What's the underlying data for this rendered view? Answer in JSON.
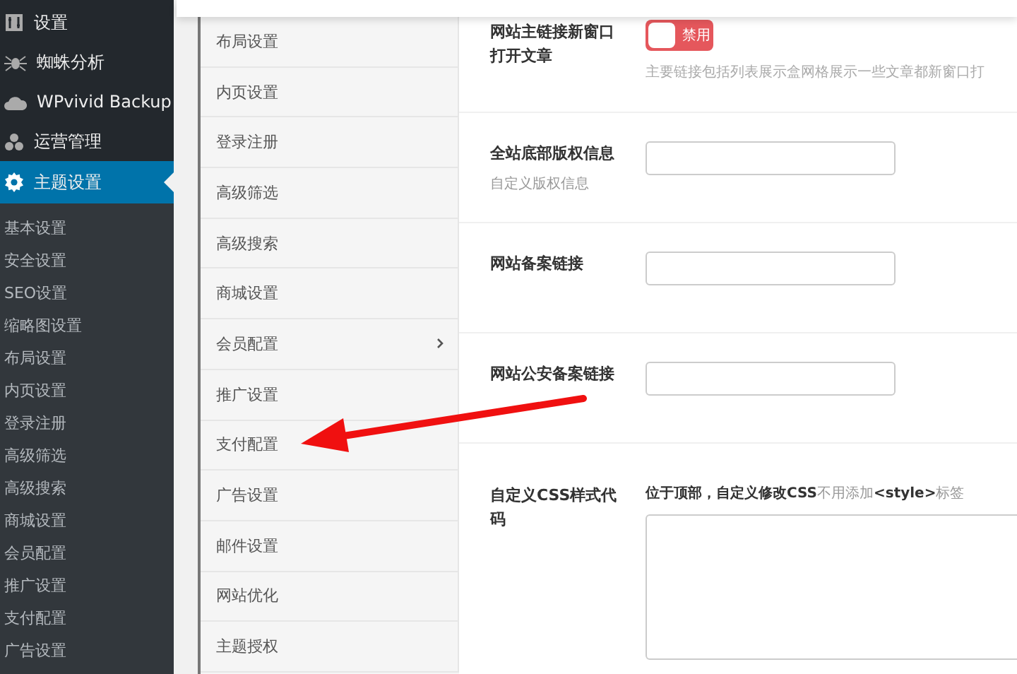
{
  "admin_menu": [
    {
      "label": "设置",
      "selected": false
    },
    {
      "label": "蜘蛛分析",
      "selected": false
    },
    {
      "label": "WPvivid Backup",
      "selected": false
    },
    {
      "label": "运营管理",
      "selected": false
    },
    {
      "label": "主题设置",
      "selected": true
    }
  ],
  "submenu": [
    "基本设置",
    "安全设置",
    "SEO设置",
    "缩略图设置",
    "布局设置",
    "内页设置",
    "登录注册",
    "高级筛选",
    "高级搜索",
    "商城设置",
    "会员配置",
    "推广设置",
    "支付配置",
    "广告设置"
  ],
  "settings_nav": [
    {
      "label": "布局设置",
      "has_children": false
    },
    {
      "label": "内页设置",
      "has_children": false
    },
    {
      "label": "登录注册",
      "has_children": false
    },
    {
      "label": "高级筛选",
      "has_children": false
    },
    {
      "label": "高级搜索",
      "has_children": false
    },
    {
      "label": "商城设置",
      "has_children": false
    },
    {
      "label": "会员配置",
      "has_children": true
    },
    {
      "label": "推广设置",
      "has_children": false
    },
    {
      "label": "支付配置",
      "has_children": false
    },
    {
      "label": "广告设置",
      "has_children": false
    },
    {
      "label": "邮件设置",
      "has_children": false
    },
    {
      "label": "网站优化",
      "has_children": false
    },
    {
      "label": "主题授权",
      "has_children": false
    }
  ],
  "fields": [
    {
      "kind": "toggle",
      "label": "网站主链接新窗口打开文章",
      "on": false,
      "toggle_text": "禁用",
      "description": "主要链接包括列表展示盒网格展示一些文章都新窗口打"
    },
    {
      "kind": "input",
      "label": "全站底部版权信息",
      "sublabel": "自定义版权信息"
    },
    {
      "kind": "input",
      "label": "网站备案链接"
    },
    {
      "kind": "input",
      "label": "网站公安备案链接"
    },
    {
      "kind": "textarea",
      "label": "自定义CSS样式代码",
      "description": "**位于顶部，自定义修改CSS**不用添加**<style>**标签"
    }
  ]
}
